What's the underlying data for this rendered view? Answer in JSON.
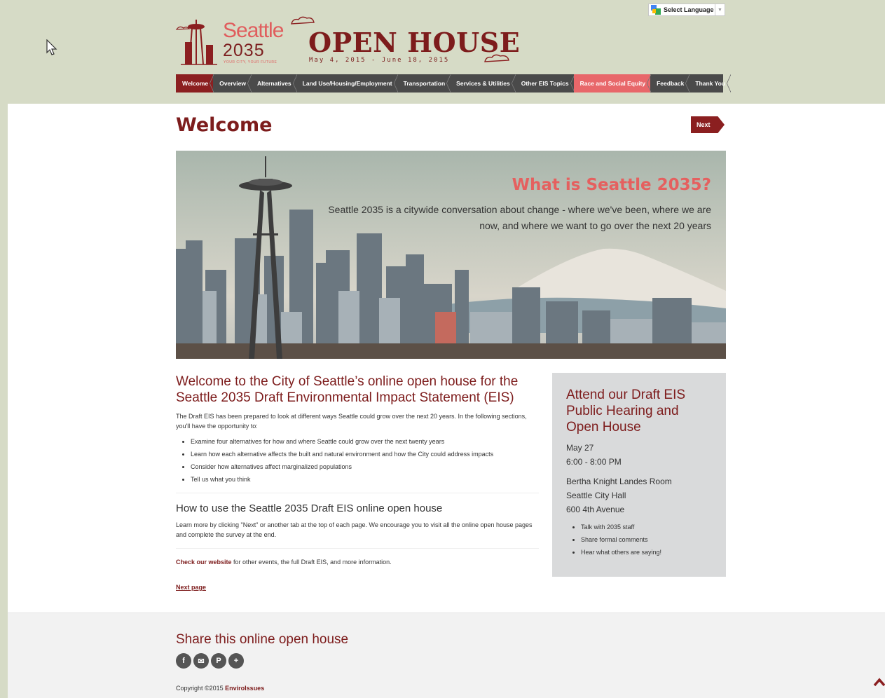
{
  "header": {
    "language_select": "Select Language",
    "logo_seattle": "Seattle",
    "logo_year": "2035",
    "logo_tagline": "YOUR CITY, YOUR FUTURE",
    "title": "OPEN HOUSE",
    "dates": "May 4, 2015 - June 18, 2015"
  },
  "nav": {
    "items": [
      {
        "label": "Welcome"
      },
      {
        "label": "Overview"
      },
      {
        "label": "Alternatives"
      },
      {
        "label": "Land Use/Housing/Employment"
      },
      {
        "label": "Transportation"
      },
      {
        "label": "Services & Utilities"
      },
      {
        "label": "Other EIS Topics"
      },
      {
        "label": "Race and Social Equity"
      },
      {
        "label": "Feedback"
      },
      {
        "label": "Thank You"
      }
    ]
  },
  "page": {
    "title": "Welcome",
    "next_label": "Next"
  },
  "hero": {
    "title": "What is Seattle 2035?",
    "text": "Seattle 2035 is a citywide conversation about change - where we've been, where we are now, and where we want to go over the next 20 years"
  },
  "content": {
    "intro_heading": "Welcome to the City of Seattle’s online open house for the Seattle 2035 Draft Environmental Impact Statement (EIS)",
    "intro_text": "The Draft EIS has been prepared to look at different ways Seattle could grow over the next 20 years. In the following sections, you'll have the opportunity to:",
    "bullets": [
      "Examine four alternatives for how and where Seattle could grow over the next twenty years",
      "Learn how each alternative affects the built and natural environment and how the City could address impacts",
      "Consider how alternatives affect marginalized populations",
      "Tell us what you think"
    ],
    "how_heading": "How to use the Seattle 2035 Draft EIS online open house",
    "how_text": "Learn more by clicking \"Next\" or another tab at the top of each page. We encourage you to visit all the online open house pages and complete the survey at the end.",
    "check_link": "Check our website",
    "check_text": " for other events, the full Draft EIS, and more information.",
    "next_page": "Next page"
  },
  "sidebar": {
    "heading": "Attend our Draft EIS Public Hearing and Open House",
    "date": "May 27",
    "time": "6:00 - 8:00 PM",
    "room": "Bertha Knight Landes Room",
    "building": "Seattle City Hall",
    "address": "600 4th Avenue",
    "bullets": [
      "Talk with 2035 staff",
      "Share formal comments",
      "Hear what others are saying!"
    ]
  },
  "footer": {
    "share_heading": "Share this online open house",
    "copyright_prefix": "Copyright ©2015 ",
    "copyright_company": "EnviroIssues",
    "share_icons": [
      "facebook-icon",
      "email-icon",
      "pinterest-icon",
      "plus-icon"
    ]
  },
  "colors": {
    "brand_dark": "#7d1c1c",
    "brand_red": "#8b1f20",
    "accent_coral": "#e5605f",
    "header_bg": "#d6dbc6",
    "nav_bg": "#4a4a4a"
  }
}
